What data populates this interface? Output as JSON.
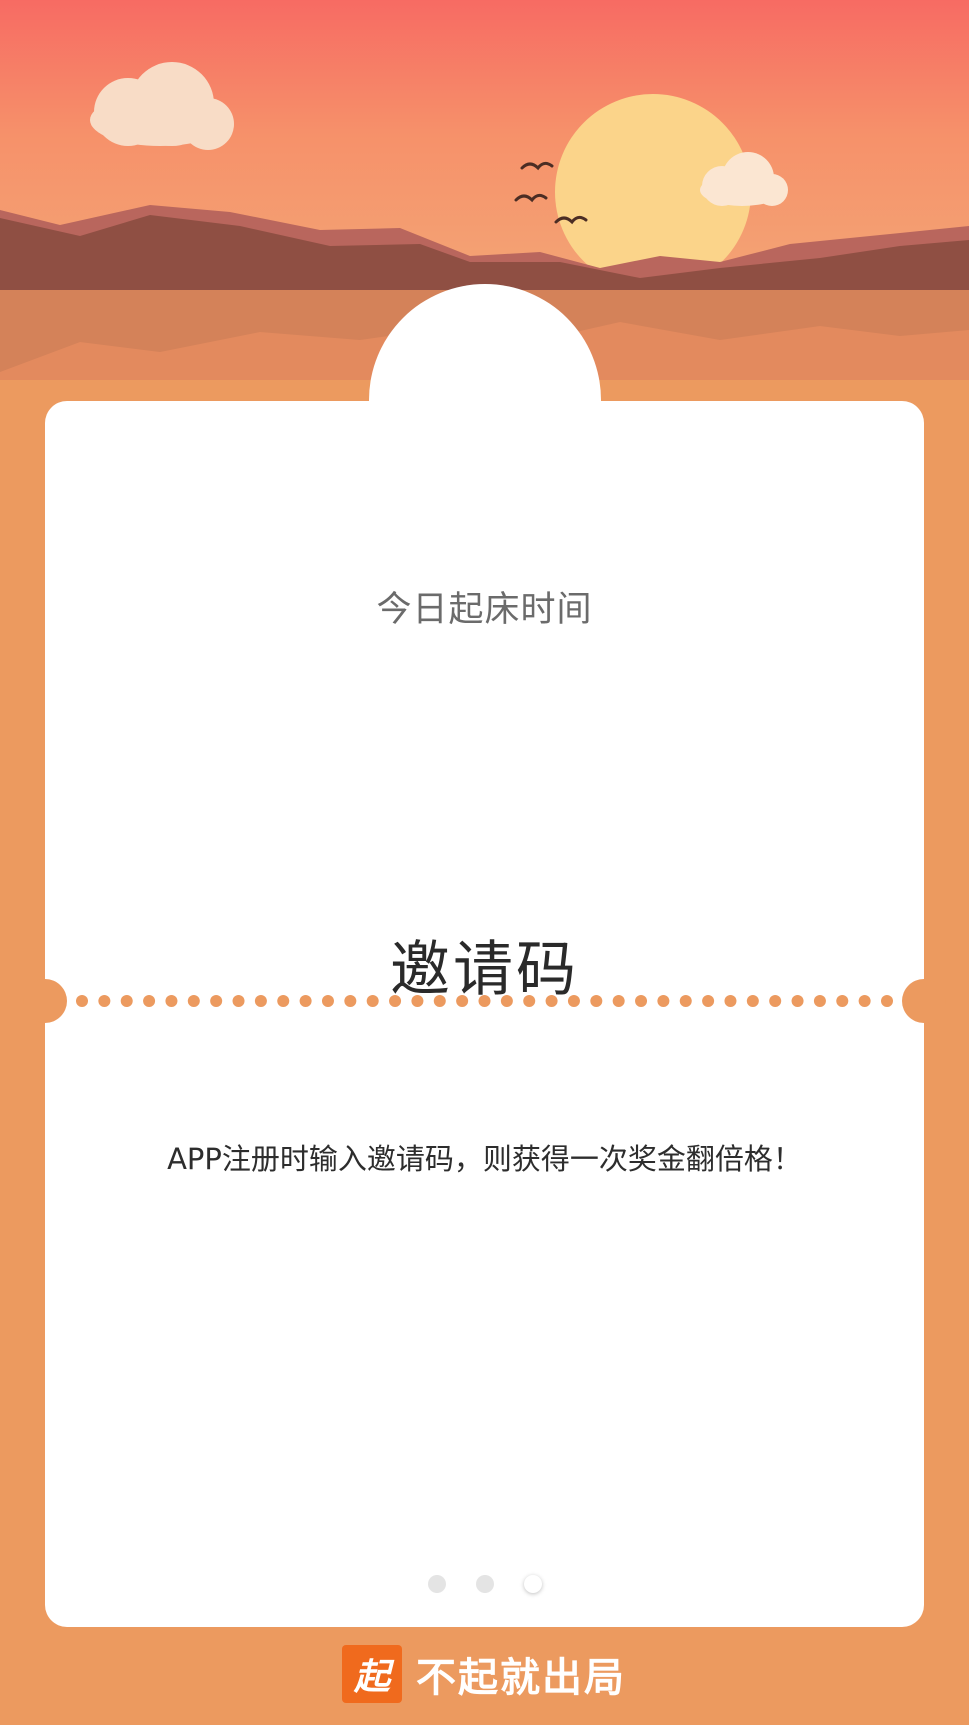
{
  "card": {
    "title": "今日起床时间",
    "invite_label": "邀请码",
    "hint": "APP注册时输入邀请码，则获得一次奖金翻倍格！"
  },
  "pagination": {
    "count": 3,
    "active_index": 2
  },
  "brand": {
    "logo_char": "起",
    "name": "不起就出局"
  },
  "colors": {
    "background": "#ec9a5f",
    "sky_top": "#f76b63",
    "sun": "#fbd48a",
    "logo": "#f06a1d"
  },
  "icons": {
    "cloud": "cloud-icon",
    "sun": "sun-icon",
    "bird": "bird-icon"
  }
}
